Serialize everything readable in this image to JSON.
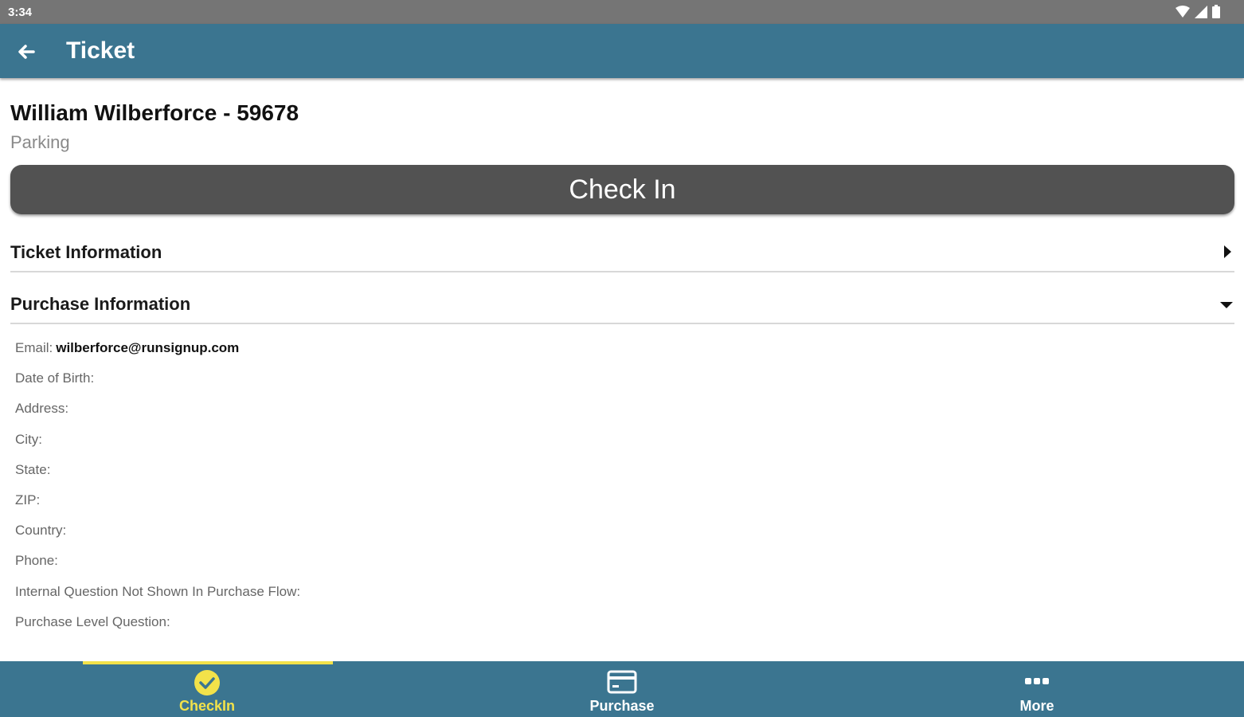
{
  "status_bar": {
    "time": "3:34"
  },
  "app_bar": {
    "title": "Ticket"
  },
  "ticket": {
    "name": "William Wilberforce - 59678",
    "type": "Parking"
  },
  "check_in_button": {
    "label": "Check In"
  },
  "sections": {
    "ticket_info": {
      "label": "Ticket Information",
      "expanded": false
    },
    "purchase_info": {
      "label": "Purchase Information",
      "expanded": true
    }
  },
  "purchase_fields": [
    {
      "label": "Email:",
      "value": "wilberforce@runsignup.com"
    },
    {
      "label": "Date of Birth:",
      "value": ""
    },
    {
      "label": "Address:",
      "value": ""
    },
    {
      "label": "City:",
      "value": ""
    },
    {
      "label": "State:",
      "value": ""
    },
    {
      "label": "ZIP:",
      "value": ""
    },
    {
      "label": "Country:",
      "value": ""
    },
    {
      "label": "Phone:",
      "value": ""
    },
    {
      "label": "Internal Question Not Shown In Purchase Flow:",
      "value": ""
    },
    {
      "label": "Purchase Level Question:",
      "value": ""
    }
  ],
  "bottom_nav": {
    "items": [
      {
        "label": "CheckIn",
        "icon": "check-circle-icon",
        "active": true
      },
      {
        "label": "Purchase",
        "icon": "credit-card-icon",
        "active": false
      },
      {
        "label": "More",
        "icon": "more-dots-icon",
        "active": false
      }
    ]
  },
  "colors": {
    "primary": "#3b7590",
    "accent": "#f2e24a",
    "button": "#525252"
  }
}
